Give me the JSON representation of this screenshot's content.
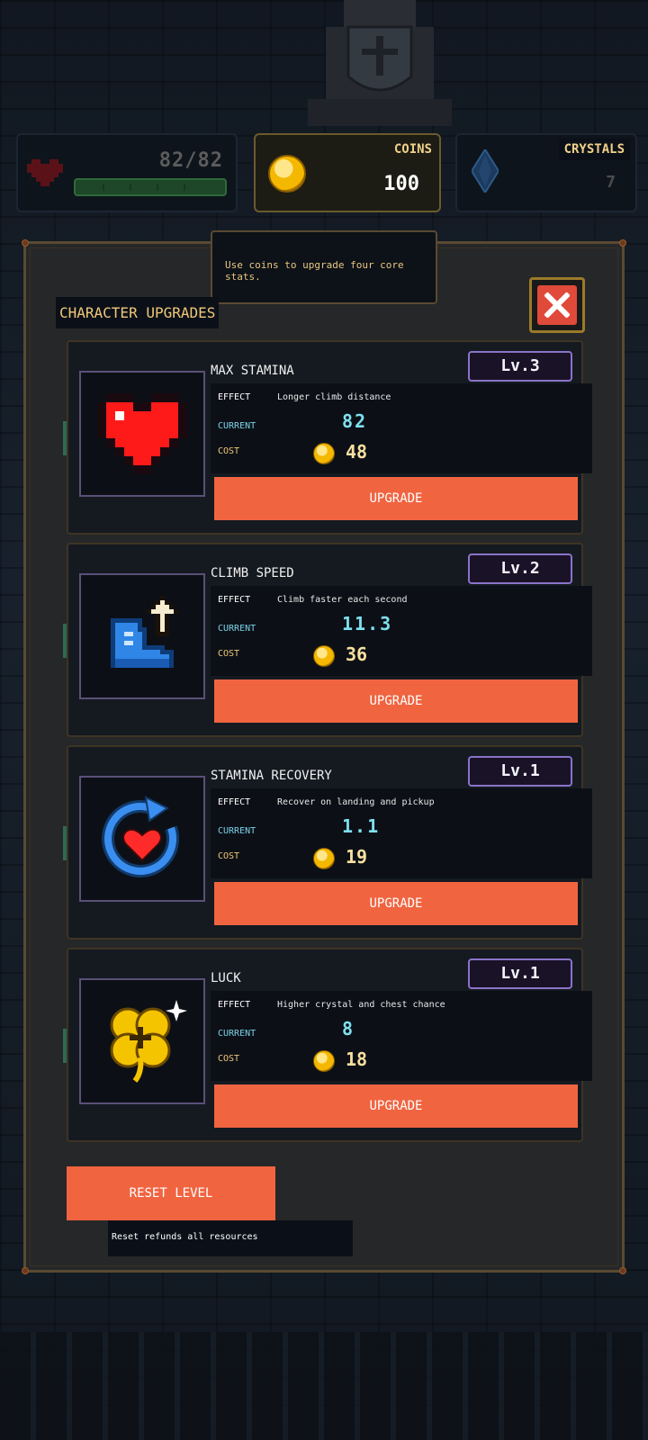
{
  "hud": {
    "hp": "82/82",
    "coins": {
      "label": "COINS",
      "value": "100"
    },
    "crystals": {
      "label": "CRYSTALS",
      "value": "7"
    }
  },
  "tooltip": "Use coins to upgrade four core stats.",
  "panel": {
    "title": "CHARACTER UPGRADES"
  },
  "labels": {
    "effect": "EFFECT",
    "current": "CURRENT",
    "cost": "COST",
    "upgrade": "UPGRADE"
  },
  "upgrades": [
    {
      "name": "MAX STAMINA",
      "level": "Lv.3",
      "effect": "Longer climb distance",
      "current": "82",
      "cost": "48",
      "icon": "heart-icon"
    },
    {
      "name": "CLIMB SPEED",
      "level": "Lv.2",
      "effect": "Climb faster each second",
      "current": "11.3",
      "cost": "36",
      "icon": "boot-icon"
    },
    {
      "name": "STAMINA RECOVERY",
      "level": "Lv.1",
      "effect": "Recover on landing and pickup",
      "current": "1.1",
      "cost": "19",
      "icon": "recovery-icon"
    },
    {
      "name": "LUCK",
      "level": "Lv.1",
      "effect": "Higher crystal and chest chance",
      "current": "8",
      "cost": "18",
      "icon": "clover-icon"
    }
  ],
  "reset": {
    "label": "RESET LEVEL",
    "note": "Reset refunds all resources"
  },
  "colors": {
    "accent": "#f06440",
    "gold": "#f5b800",
    "level_border": "#8a74c8",
    "current_value": "#7ee0f0"
  }
}
